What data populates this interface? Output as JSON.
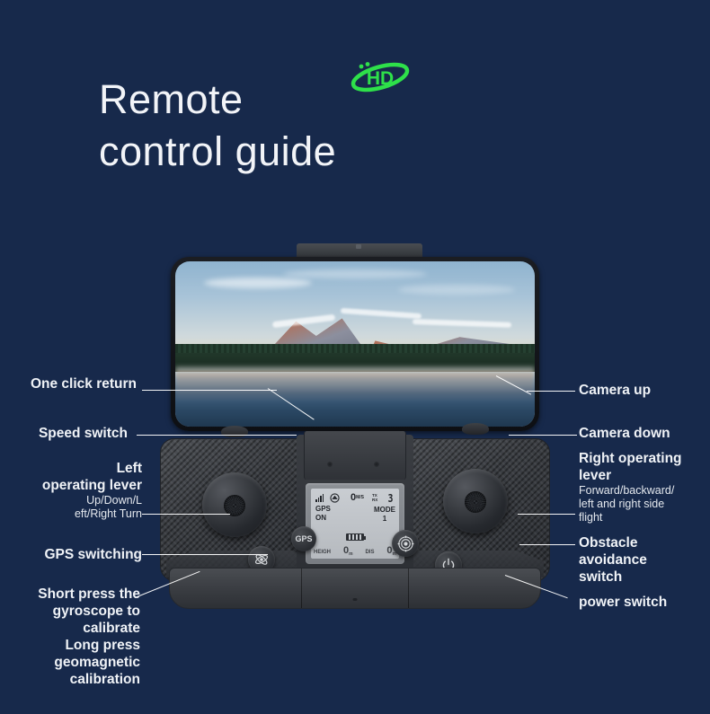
{
  "page": {
    "background_color": "#17294b",
    "text_color": "#f0f3f7",
    "accent_color": "#2ee04a"
  },
  "title": {
    "line1": "Remote",
    "line2": "control guide"
  },
  "logo": {
    "text": "HD",
    "name": "hd-logo",
    "color": "#2ee04a"
  },
  "labels_left": [
    {
      "id": "one-click-return",
      "main": "One click return",
      "sub": ""
    },
    {
      "id": "speed-switch",
      "main": "Speed switch",
      "sub": ""
    },
    {
      "id": "left-operating-lever",
      "main": "Left\noperating lever",
      "main_l1": "Left",
      "main_l2": "operating lever",
      "sub_l1": "Up/Down/L",
      "sub_l2": "eft/Right Turn"
    },
    {
      "id": "gps-switching",
      "main": "GPS switching",
      "sub": ""
    },
    {
      "id": "gyroscope-calibration",
      "main_l1": "Short press the",
      "main_l2": "gyroscope to",
      "main_l3": "calibrate",
      "main_l4": "Long press",
      "main_l5": "geomagnetic",
      "main_l6": "calibration"
    }
  ],
  "labels_right": [
    {
      "id": "camera-up",
      "main": "Camera up"
    },
    {
      "id": "camera-down",
      "main": "Camera down"
    },
    {
      "id": "right-operating-lever",
      "main_l1": "Right operating",
      "main_l2": "lever",
      "sub_l1": "Forward/backward/",
      "sub_l2": "left and right side",
      "sub_l3": "flight"
    },
    {
      "id": "obstacle-avoidance-switch",
      "main_l1": "Obstacle",
      "main_l2": "avoidance",
      "main_l3": "switch"
    },
    {
      "id": "power-switch",
      "main": "power switch"
    }
  ],
  "remote": {
    "buttons": {
      "gps": "GPS",
      "gyro_icon": "gyroscope-icon",
      "obstacle_icon": "radar-icon",
      "power_icon": "power-icon"
    },
    "lcd": {
      "signal_icon": "signal-bars-icon",
      "satellite_icon": "satellite-icon",
      "speed_value": "0",
      "speed_unit": "M/S",
      "tx_label": "TX",
      "rx_label": "RX",
      "sat_count": "3",
      "gps_label": "GPS",
      "gps_state": "ON",
      "mode_label": "MODE",
      "mode_value": "1",
      "battery_icon": "battery-icon",
      "height_label": "HEIGH",
      "height_value": "0",
      "height_unit": "m",
      "distance_label": "DIS",
      "distance_value": "0",
      "distance_unit": "m"
    }
  },
  "phone": {
    "screen_content": "mountain-lake-photo"
  }
}
